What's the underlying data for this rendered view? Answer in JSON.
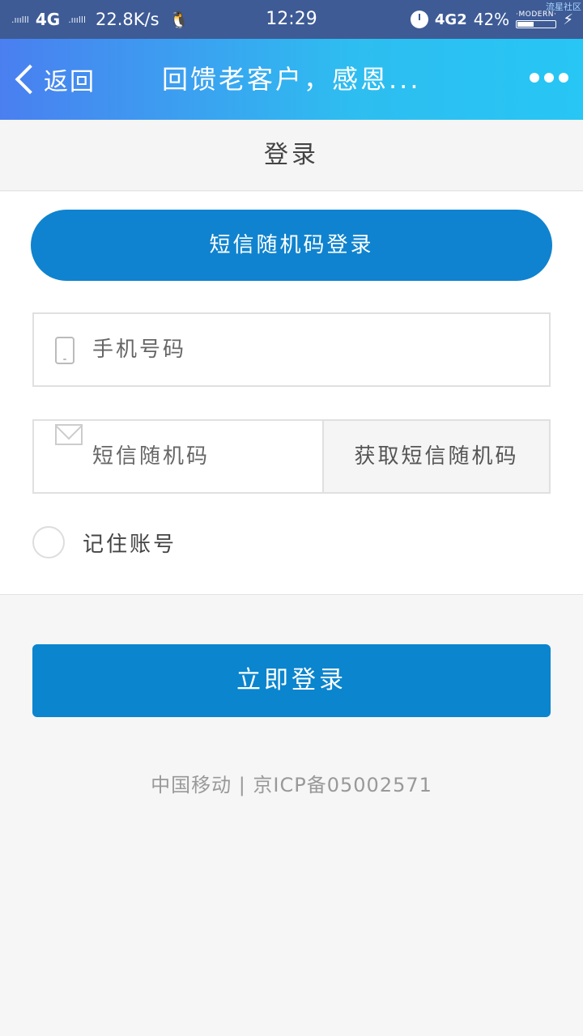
{
  "status_bar": {
    "signal1": ".ııılll",
    "network1": "4G",
    "signal2": ".ııılll",
    "speed": "22.8K/s",
    "time": "12:29",
    "network2": "4G2",
    "battery_percent": "42%",
    "battery_label": "·MODERN·",
    "battery_level": 0.42,
    "watermark": "流星社区"
  },
  "header": {
    "back_label": "返回",
    "title": "回馈老客户，感恩..."
  },
  "page": {
    "title": "登录"
  },
  "form": {
    "sms_tab_label": "短信随机码登录",
    "phone_placeholder": "手机号码",
    "code_placeholder": "短信随机码",
    "get_code_label": "获取短信随机码",
    "remember_label": "记住账号",
    "login_label": "立即登录"
  },
  "footer": {
    "text": "中国移动 | 京ICP备05002571"
  },
  "colors": {
    "primary": "#0a85ce",
    "header_start": "#4a7ff0",
    "header_end": "#27c6f4"
  }
}
